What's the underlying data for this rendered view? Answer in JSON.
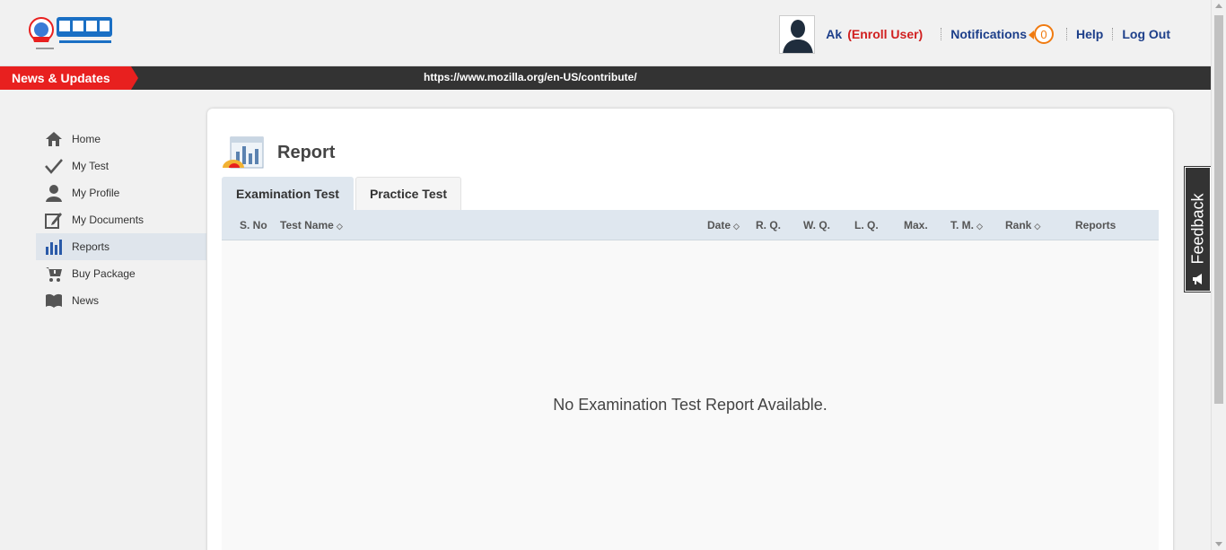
{
  "header": {
    "logo_icon": "suvam-education-logo",
    "user_name": "Ak",
    "user_role": "(Enroll User)",
    "notifications_label": "Notifications",
    "notifications_count": "0",
    "help_label": "Help",
    "logout_label": "Log Out"
  },
  "newsbar": {
    "label": "News & Updates",
    "ticker_text": "https://www.mozilla.org/en-US/contribute/"
  },
  "sidebar": {
    "items": [
      {
        "label": "Home",
        "icon": "home-icon"
      },
      {
        "label": "My Test",
        "icon": "check-icon"
      },
      {
        "label": "My Profile",
        "icon": "user-icon"
      },
      {
        "label": "My Documents",
        "icon": "edit-document-icon"
      },
      {
        "label": "Reports",
        "icon": "bar-chart-icon",
        "active": true
      },
      {
        "label": "Buy Package",
        "icon": "cart-icon"
      },
      {
        "label": "News",
        "icon": "book-icon"
      }
    ]
  },
  "main": {
    "title": "Report",
    "tabs": [
      {
        "label": "Examination Test",
        "active": true
      },
      {
        "label": "Practice Test",
        "active": false
      }
    ],
    "columns": [
      "S. No",
      "Test Name",
      "Date",
      "R. Q.",
      "W. Q.",
      "L. Q.",
      "Max.",
      "T. M.",
      "Rank",
      "Reports"
    ],
    "empty_message": "No Examination Test Report Available."
  },
  "feedback": {
    "label": "Feedback",
    "icon": "megaphone-icon"
  },
  "colors": {
    "accent_red": "#e8201f",
    "link_blue": "#1d3f8a",
    "badge_orange": "#f07b11",
    "table_header_bg": "#dfe7ef"
  }
}
